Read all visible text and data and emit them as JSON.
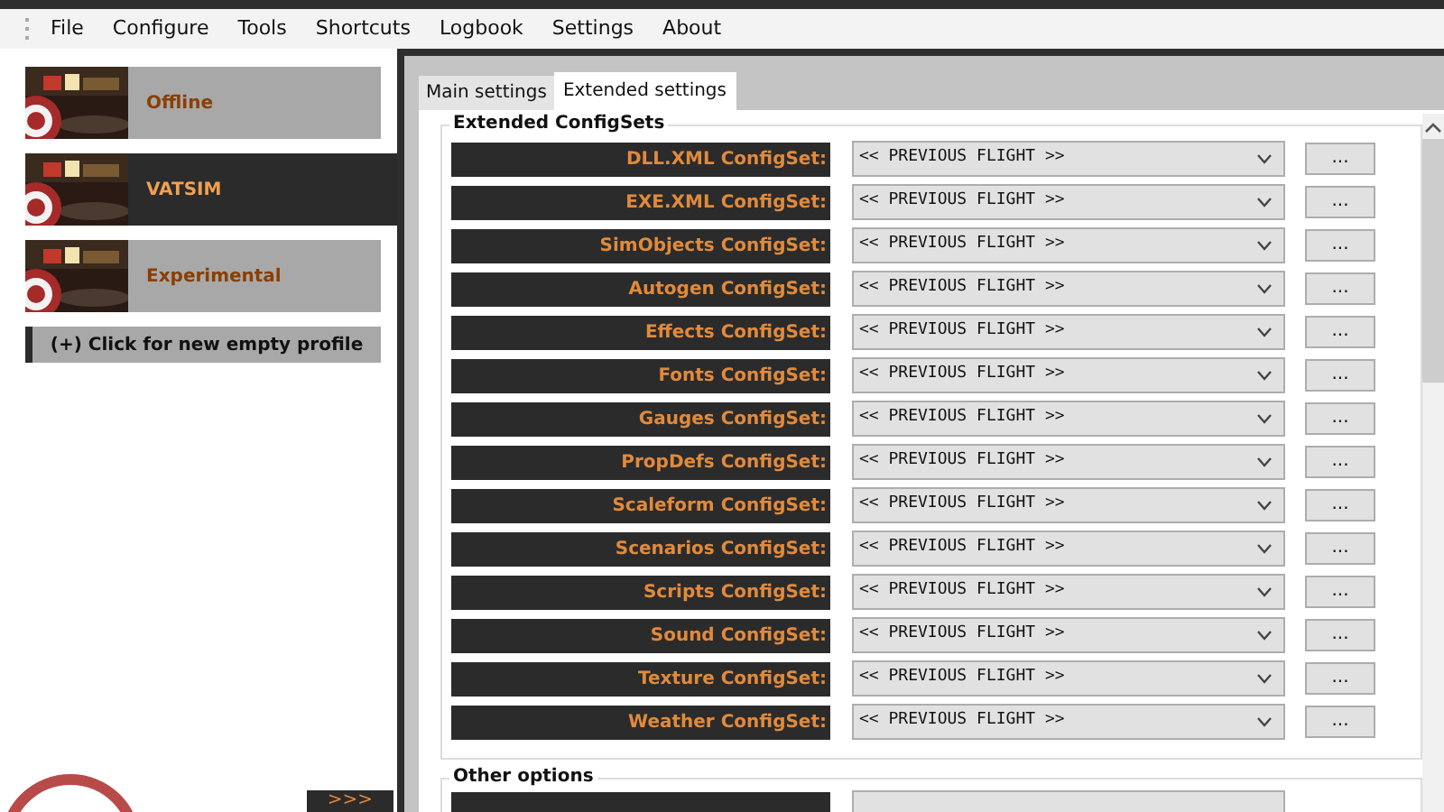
{
  "menu": [
    "File",
    "Configure",
    "Tools",
    "Shortcuts",
    "Logbook",
    "Settings",
    "About"
  ],
  "profiles": [
    {
      "label": "Offline",
      "selected": false
    },
    {
      "label": "VATSIM",
      "selected": true
    },
    {
      "label": "Experimental",
      "selected": false
    }
  ],
  "new_profile_button": "(+) Click for new empty profile",
  "expand_button": ">>>",
  "tabs": [
    {
      "label": "Main settings",
      "selected": false
    },
    {
      "label": "Extended settings",
      "selected": true
    }
  ],
  "configsets": {
    "title": "Extended ConfigSets",
    "rows": [
      {
        "label": "DLL.XML ConfigSet:",
        "value": "<< PREVIOUS FLIGHT >>",
        "button": "..."
      },
      {
        "label": "EXE.XML ConfigSet:",
        "value": "<< PREVIOUS FLIGHT >>",
        "button": "..."
      },
      {
        "label": "SimObjects ConfigSet:",
        "value": "<< PREVIOUS FLIGHT >>",
        "button": "..."
      },
      {
        "label": "Autogen ConfigSet:",
        "value": "<< PREVIOUS FLIGHT >>",
        "button": "..."
      },
      {
        "label": "Effects ConfigSet:",
        "value": "<< PREVIOUS FLIGHT >>",
        "button": "..."
      },
      {
        "label": "Fonts ConfigSet:",
        "value": "<< PREVIOUS FLIGHT >>",
        "button": "..."
      },
      {
        "label": "Gauges ConfigSet:",
        "value": "<< PREVIOUS FLIGHT >>",
        "button": "..."
      },
      {
        "label": "PropDefs ConfigSet:",
        "value": "<< PREVIOUS FLIGHT >>",
        "button": "..."
      },
      {
        "label": "Scaleform ConfigSet:",
        "value": "<< PREVIOUS FLIGHT >>",
        "button": "..."
      },
      {
        "label": "Scenarios ConfigSet:",
        "value": "<< PREVIOUS FLIGHT >>",
        "button": "..."
      },
      {
        "label": "Scripts ConfigSet:",
        "value": "<< PREVIOUS FLIGHT >>",
        "button": "..."
      },
      {
        "label": "Sound ConfigSet:",
        "value": "<< PREVIOUS FLIGHT >>",
        "button": "..."
      },
      {
        "label": "Texture ConfigSet:",
        "value": "<< PREVIOUS FLIGHT >>",
        "button": "..."
      },
      {
        "label": "Weather ConfigSet:",
        "value": "<< PREVIOUS FLIGHT >>",
        "button": "..."
      }
    ]
  },
  "other_options": {
    "title": "Other options"
  }
}
